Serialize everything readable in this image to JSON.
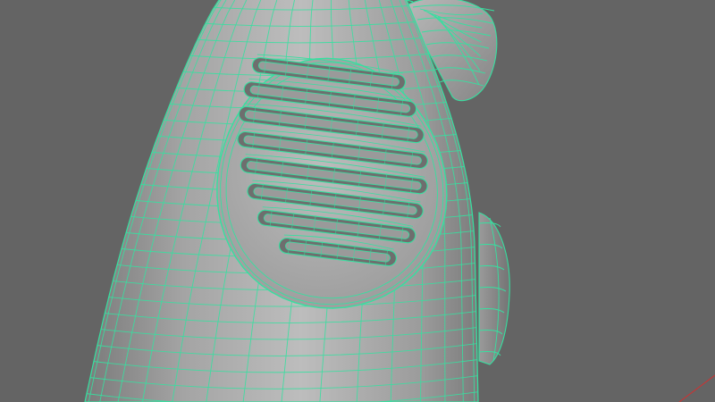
{
  "viewport": {
    "background_color": "#646464",
    "wire_color": "#36e0a0",
    "shade_light": "#b8b8b8",
    "shade_mid": "#9a9a9a",
    "shade_dark": "#6e6e6e",
    "axis_x_color": "#d23030"
  },
  "model": {
    "shading": "smooth-shaded-with-wireframe-on-shaded",
    "component": "handle-with-vent-grille",
    "vent_slot_count": 8
  }
}
